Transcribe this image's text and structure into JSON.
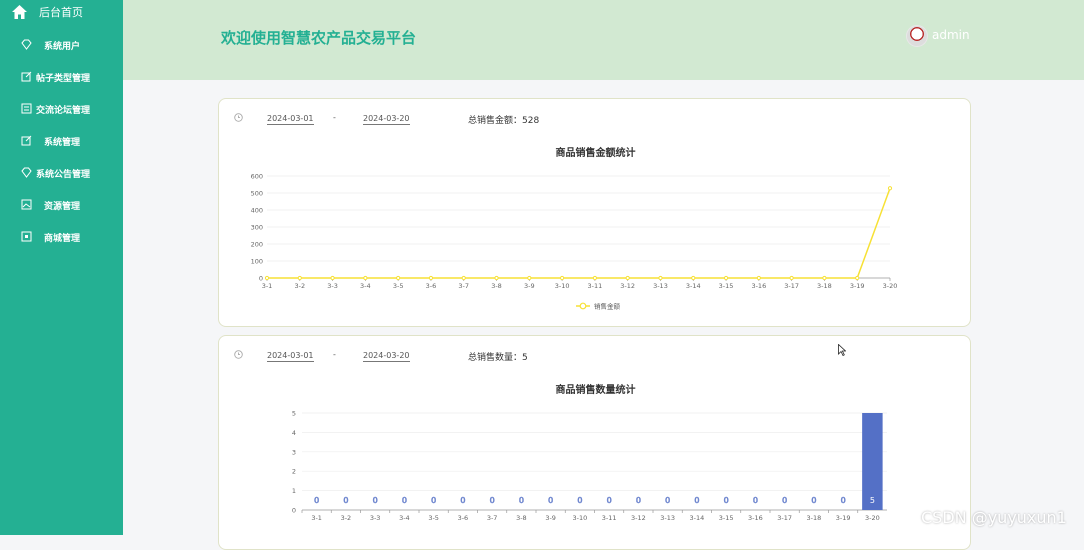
{
  "sidebar": {
    "home_label": "后台首页",
    "items": [
      {
        "label": "系统用户",
        "icon": "diamond-icon"
      },
      {
        "label": "帖子类型管理",
        "icon": "edit-icon"
      },
      {
        "label": "交流论坛管理",
        "icon": "list-icon"
      },
      {
        "label": "系统管理",
        "icon": "edit-icon"
      },
      {
        "label": "系统公告管理",
        "icon": "diamond-icon"
      },
      {
        "label": "资源管理",
        "icon": "image-icon"
      },
      {
        "label": "商城管理",
        "icon": "shop-icon"
      }
    ]
  },
  "header": {
    "title": "欢迎使用智慧农产品交易平台",
    "user": "admin"
  },
  "sales_card": {
    "start_date": "2024-03-01",
    "separator": "-",
    "end_date": "2024-03-20",
    "total_text": "总销售金额：528"
  },
  "quantity_card": {
    "start_date": "2024-03-01",
    "separator": "-",
    "end_date": "2024-03-20",
    "total_text": "总销售数量：5"
  },
  "watermark": "CSDN @yuyuxun1",
  "colors": {
    "accent": "#24b093",
    "header_bg": "#d2e9d2",
    "line": "#f7e135",
    "bar": "#5470c6"
  },
  "chart_data": [
    {
      "type": "line",
      "title": "商品销售金额统计",
      "categories": [
        "3-1",
        "3-2",
        "3-3",
        "3-4",
        "3-5",
        "3-6",
        "3-7",
        "3-8",
        "3-9",
        "3-10",
        "3-11",
        "3-12",
        "3-13",
        "3-14",
        "3-15",
        "3-16",
        "3-17",
        "3-18",
        "3-19",
        "3-20"
      ],
      "series": [
        {
          "name": "销售金额",
          "values": [
            0,
            0,
            0,
            0,
            0,
            0,
            0,
            0,
            0,
            0,
            0,
            0,
            0,
            0,
            0,
            0,
            0,
            0,
            0,
            528
          ]
        }
      ],
      "ylim": [
        0,
        600
      ],
      "yticks": [
        0,
        100,
        200,
        300,
        400,
        500,
        600
      ],
      "legend": "bottom-center",
      "grid": true
    },
    {
      "type": "bar",
      "title": "商品销售数量统计",
      "categories": [
        "3-1",
        "3-2",
        "3-3",
        "3-4",
        "3-5",
        "3-6",
        "3-7",
        "3-8",
        "3-9",
        "3-10",
        "3-11",
        "3-12",
        "3-13",
        "3-14",
        "3-15",
        "3-16",
        "3-17",
        "3-18",
        "3-19",
        "3-20"
      ],
      "series": [
        {
          "values": [
            0,
            0,
            0,
            0,
            0,
            0,
            0,
            0,
            0,
            0,
            0,
            0,
            0,
            0,
            0,
            0,
            0,
            0,
            0,
            5
          ]
        }
      ],
      "ylim": [
        0,
        5
      ],
      "yticks": [
        0,
        1,
        2,
        3,
        4,
        5
      ],
      "data_labels": true,
      "grid": true
    }
  ]
}
